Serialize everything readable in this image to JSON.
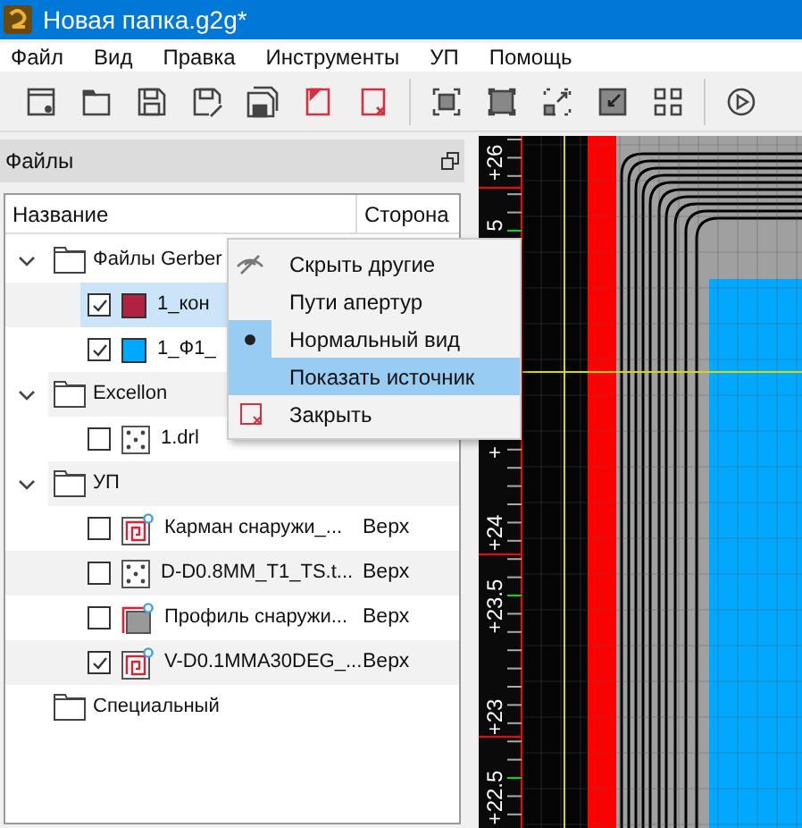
{
  "window": {
    "title": "Новая папка.g2g*"
  },
  "menu": [
    "Файл",
    "Вид",
    "Правка",
    "Инструменты",
    "УП",
    "Помощь"
  ],
  "files_panel": {
    "title": "Файлы",
    "columns": [
      "Название",
      "Сторона"
    ],
    "tree": [
      {
        "kind": "folder",
        "label": "Файлы Gerber",
        "expanded": true,
        "children": [
          {
            "kind": "swatch",
            "label": "1_кон",
            "checked": true,
            "selected": true,
            "color": "#b0223f"
          },
          {
            "kind": "swatch",
            "label": "1_Ф1_",
            "checked": true,
            "selected": false,
            "color": "#00a8ff"
          }
        ]
      },
      {
        "kind": "folder",
        "label": "Excellon",
        "expanded": true,
        "children": [
          {
            "kind": "drill",
            "label": "1.drl",
            "checked": false,
            "selected": false
          }
        ]
      },
      {
        "kind": "folder",
        "label": "УП",
        "expanded": true,
        "children": [
          {
            "kind": "pocket",
            "label": "Карман снаружи_...",
            "side": "Верх",
            "checked": false,
            "selected": false
          },
          {
            "kind": "drill",
            "label": "D-D0.8MM_T1_TS.t...",
            "side": "Верх",
            "checked": false,
            "selected": false
          },
          {
            "kind": "profile",
            "label": "Профиль снаружи...",
            "side": "Верх",
            "checked": false,
            "selected": false
          },
          {
            "kind": "pocket",
            "label": "V-D0.1MMA30DEG_...",
            "side": "Верх",
            "checked": true,
            "selected": false
          }
        ]
      },
      {
        "kind": "folder",
        "label": "Специальный",
        "expanded": false
      }
    ]
  },
  "ruler": [
    "+26",
    "5",
    "+",
    "+24",
    "+23.5",
    "+23",
    "+22.5"
  ],
  "context_menu": [
    {
      "kind": "hide",
      "label": "Скрыть другие",
      "checked": false,
      "selected": false
    },
    {
      "kind": "plain",
      "label": "Пути апертур",
      "checked": false,
      "selected": false
    },
    {
      "kind": "plain",
      "label": "Нормальный вид",
      "checked": true,
      "selected": false
    },
    {
      "kind": "plain",
      "label": "Показать источник",
      "checked": false,
      "selected": true
    },
    {
      "kind": "close",
      "label": "Закрыть",
      "checked": false,
      "selected": false
    }
  ]
}
